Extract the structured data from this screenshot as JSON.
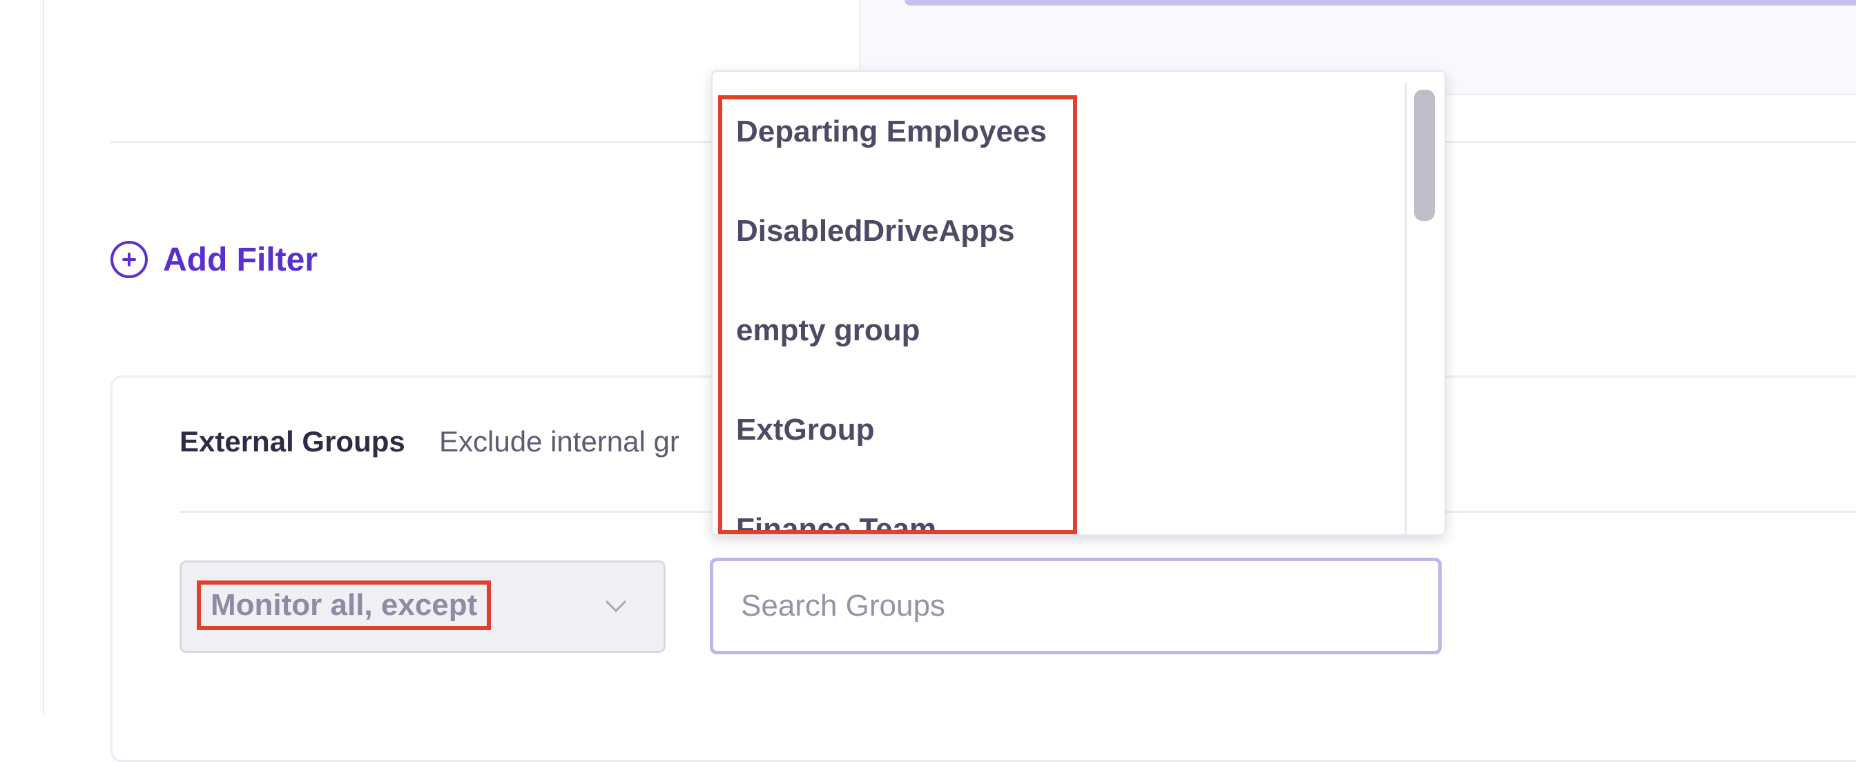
{
  "filter": {
    "add_label": "Add Filter"
  },
  "external_groups": {
    "title": "External Groups",
    "description": "Exclude internal gr",
    "mode": {
      "selected": "Monitor all, except"
    },
    "search": {
      "placeholder": "Search Groups",
      "value": ""
    },
    "dropdown": {
      "items": [
        "Departing Employees",
        "DisabledDriveApps",
        "empty group",
        "ExtGroup",
        "Finance Team"
      ]
    }
  },
  "colors": {
    "accent": "#5a2fd0",
    "highlight": "#e0412c",
    "input_focus_border": "#c4b4ec"
  },
  "icons": {
    "add_filter": "plus-circle-icon",
    "mode_select": "chevron-down-icon"
  }
}
